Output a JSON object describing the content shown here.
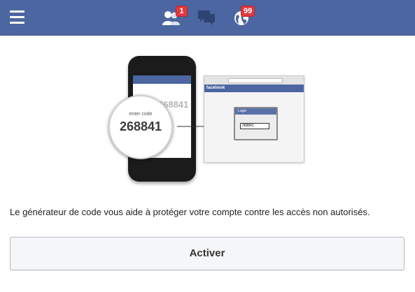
{
  "header": {
    "friend_requests_count": "1",
    "notifications_count": "99",
    "colors": {
      "bar": "#4b66a0",
      "badge": "#e0393e"
    },
    "icons": [
      "menu-icon",
      "friends-icon",
      "messages-icon",
      "globe-notifications-icon"
    ]
  },
  "illustration": {
    "phone_code_partial": "268841",
    "code_circle_label": "enter code",
    "code_circle_value": "268841",
    "browser_brand": "facebook",
    "login_title": "Login",
    "login_field_value": "268841"
  },
  "main": {
    "description": "Le générateur de code vous aide à protéger votre compte contre les accès non autorisés.",
    "activate_label": "Activer"
  }
}
